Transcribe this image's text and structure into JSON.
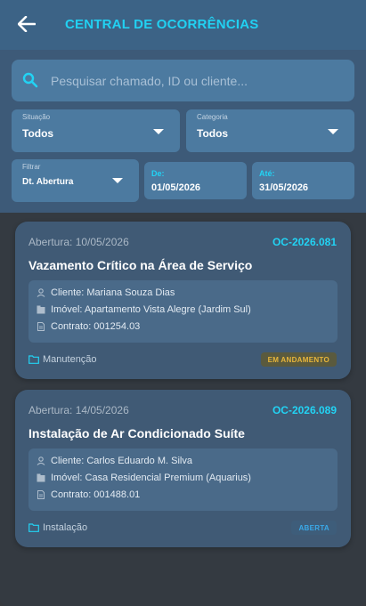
{
  "header": {
    "title": "CENTRAL DE OCORRÊNCIAS",
    "back_icon": "arrow-left-icon"
  },
  "search": {
    "placeholder": "Pesquisar chamado, ID ou cliente...",
    "value": ""
  },
  "filters": {
    "situacao": {
      "caption": "Situação",
      "value": "Todos"
    },
    "categoria": {
      "caption": "Categoria",
      "value": "Todos"
    },
    "filtrar": {
      "caption": "Filtrar",
      "value": "Dt. Abertura"
    },
    "de": {
      "caption": "De:",
      "value": "01/05/2026"
    },
    "ate": {
      "caption": "Até:",
      "value": "31/05/2026"
    }
  },
  "tickets": [
    {
      "opened": "Abertura: 10/05/2026",
      "code": "OC-2026.081",
      "title": "Vazamento Crítico na Área de Serviço",
      "client": "Cliente: Mariana Souza Dias",
      "property": "Imóvel: Apartamento Vista Alegre (Jardim Sul)",
      "contract": "Contrato: 001254.03",
      "category": "Manutenção",
      "status": "EM ANDAMENTO",
      "status_color": "#e8b63a",
      "status_bg": "#5a5a3e"
    },
    {
      "opened": "Abertura: 14/05/2026",
      "code": "OC-2026.089",
      "title": "Instalação de Ar Condicionado Suíte",
      "client": "Cliente: Carlos Eduardo M. Silva",
      "property": "Imóvel: Casa Residencial Premium (Aquarius)",
      "contract": "Contrato: 001488.01",
      "category": "Instalação",
      "status": "ABERTA",
      "status_color": "#3aa9e8",
      "status_bg": "#3e5d7a"
    }
  ],
  "colors": {
    "accent": "#22d3f4",
    "header_bg": "#3c6386",
    "panel_bg": "#3d5a78",
    "card_bg": "#405a75"
  }
}
